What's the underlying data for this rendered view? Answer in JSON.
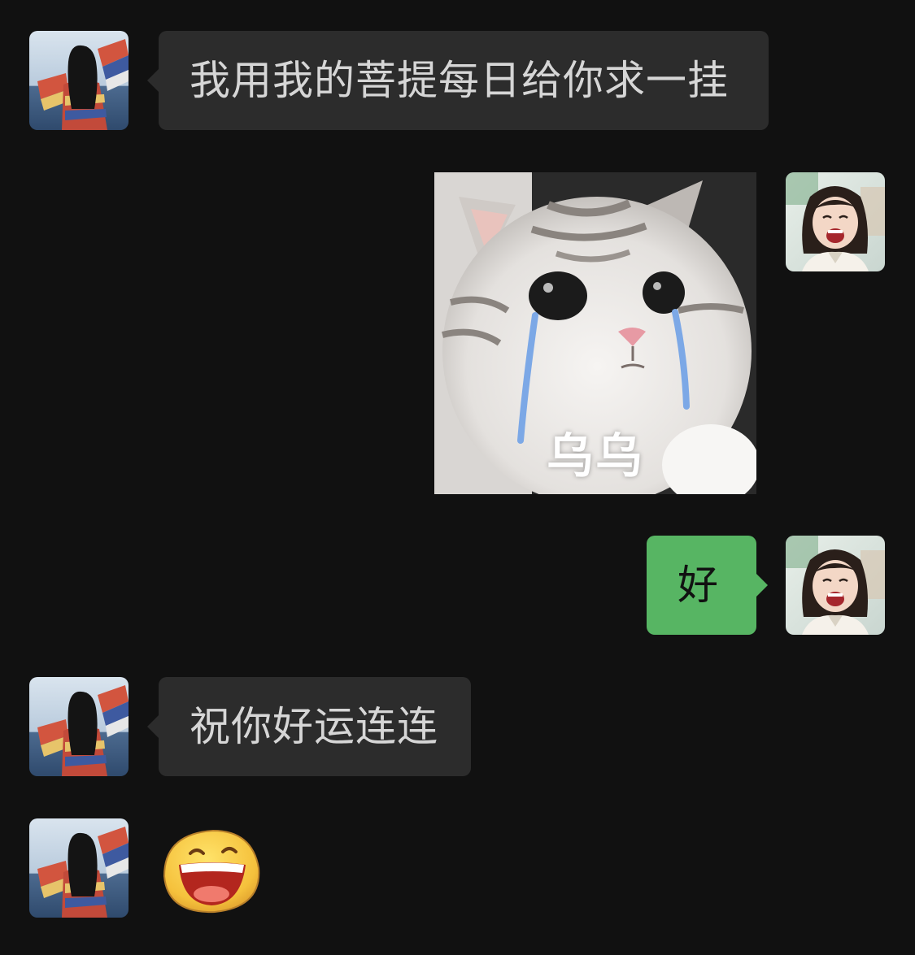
{
  "chat": {
    "messages": [
      {
        "sender": "contact",
        "type": "text",
        "text": "我用我的菩提每日给你求一挂"
      },
      {
        "sender": "me",
        "type": "sticker",
        "sticker": "crying-cat-sticker",
        "caption": "乌乌"
      },
      {
        "sender": "me",
        "type": "text",
        "text": "好"
      },
      {
        "sender": "contact",
        "type": "text",
        "text": "祝你好运连连"
      },
      {
        "sender": "contact",
        "type": "emoji",
        "emoji": "laughing-face-emoji"
      }
    ]
  },
  "icons": {
    "contact_avatar": "woman-back-view-avatar",
    "my_avatar": "laughing-girl-avatar"
  },
  "colors": {
    "background": "#111111",
    "incoming_bubble": "#2c2c2c",
    "incoming_text": "#d6d6d6",
    "outgoing_bubble": "#57b563",
    "outgoing_text": "#111111"
  }
}
